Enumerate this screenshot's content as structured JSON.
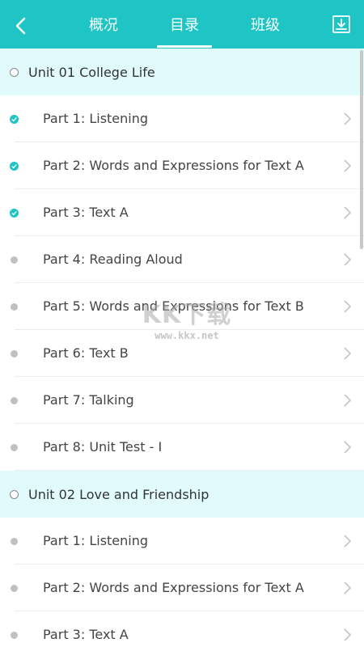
{
  "header": {
    "tabs": [
      {
        "label": "概况",
        "active": false
      },
      {
        "label": "目录",
        "active": true
      },
      {
        "label": "班级",
        "active": false
      }
    ],
    "accent_color": "#1fc4c4"
  },
  "units": [
    {
      "title": "Unit 01 College Life",
      "parts": [
        {
          "label": "Part 1: Listening",
          "status": "completed"
        },
        {
          "label": "Part 2: Words and Expressions for Text A",
          "status": "completed"
        },
        {
          "label": "Part 3: Text A",
          "status": "completed"
        },
        {
          "label": "Part 4: Reading Aloud",
          "status": "not-started"
        },
        {
          "label": "Part 5: Words and Expressions for Text B",
          "status": "not-started"
        },
        {
          "label": "Part 6: Text B",
          "status": "not-started"
        },
        {
          "label": "Part 7: Talking",
          "status": "not-started"
        },
        {
          "label": "Part 8: Unit Test - I",
          "status": "not-started"
        }
      ]
    },
    {
      "title": "Unit 02 Love and Friendship",
      "parts": [
        {
          "label": "Part 1: Listening",
          "status": "not-started"
        },
        {
          "label": "Part 2: Words and Expressions for Text A",
          "status": "not-started"
        },
        {
          "label": "Part 3: Text A",
          "status": "not-started"
        }
      ]
    }
  ],
  "watermark": {
    "main": "KK下载",
    "sub": "www.kkx.net"
  }
}
